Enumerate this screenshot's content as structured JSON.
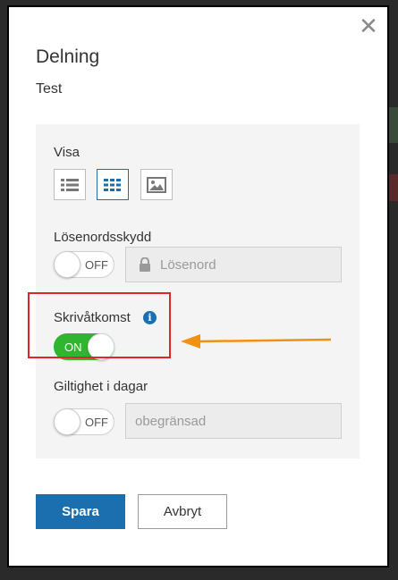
{
  "dialog": {
    "title": "Delning",
    "subtitle": "Test",
    "close_icon": "close-icon"
  },
  "visa": {
    "label": "Visa",
    "buttons": [
      {
        "icon": "list-view-icon",
        "selected": false
      },
      {
        "icon": "grid-view-icon",
        "selected": true
      },
      {
        "icon": "image-view-icon",
        "selected": false
      }
    ]
  },
  "password": {
    "label": "Lösenordsskydd",
    "toggle_text": "OFF",
    "placeholder": "Lösenord",
    "icon": "lock-icon"
  },
  "write_access": {
    "label": "Skrivåtkomst",
    "toggle_text": "ON",
    "info_glyph": "i"
  },
  "validity": {
    "label": "Giltighet i dagar",
    "toggle_text": "OFF",
    "placeholder": "obegränsad"
  },
  "actions": {
    "save_label": "Spara",
    "cancel_label": "Avbryt"
  },
  "colors": {
    "accent": "#1b6fae",
    "toggle_on": "#2fb52f",
    "highlight": "#e0262a",
    "arrow": "#f29111"
  }
}
